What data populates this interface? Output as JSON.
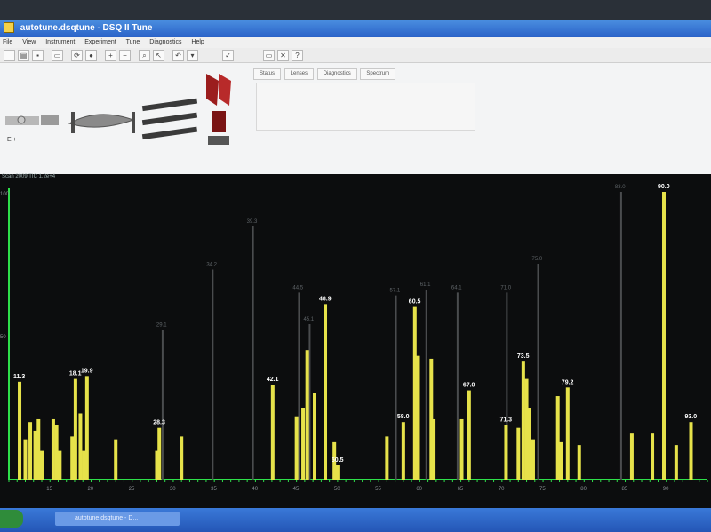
{
  "window": {
    "title": "autotune.dsqtune - DSQ II Tune",
    "menu": [
      "File",
      "View",
      "Instrument",
      "Experiment",
      "Tune",
      "Diagnostics",
      "Help"
    ]
  },
  "instrument": {
    "ei_label": "EI+"
  },
  "tabs": [
    "Status",
    "Lenses",
    "Diagnostics",
    "Spectrum"
  ],
  "plot": {
    "scan_label": "Scan 2009 TIC 1.2e+4",
    "y_top_label": "100",
    "y_mid_label": "50"
  },
  "taskbar": {
    "item_label": "autotune.dsqtune - D..."
  },
  "chart_data": {
    "type": "bar",
    "title": "",
    "xlabel": "",
    "ylabel": "",
    "xlim": [
      10,
      95
    ],
    "ylim": [
      0,
      100
    ],
    "x_ticks": [
      15,
      20,
      25,
      30,
      35,
      40,
      45,
      50,
      55,
      60,
      65,
      70,
      75,
      80,
      85,
      90
    ],
    "colors": {
      "bright": "#e6e24a",
      "faint": "#4a4c4e",
      "axis": "#2ee04a"
    },
    "peaks": [
      {
        "x": 11.3,
        "y": 34,
        "label": "11.3",
        "bright": true
      },
      {
        "x": 12.0,
        "y": 14,
        "bright": true
      },
      {
        "x": 12.6,
        "y": 20,
        "bright": true
      },
      {
        "x": 13.2,
        "y": 17,
        "bright": true
      },
      {
        "x": 13.6,
        "y": 21,
        "bright": true
      },
      {
        "x": 14.0,
        "y": 10,
        "bright": true
      },
      {
        "x": 15.4,
        "y": 21,
        "bright": true
      },
      {
        "x": 15.8,
        "y": 19,
        "bright": true
      },
      {
        "x": 16.2,
        "y": 10,
        "bright": true
      },
      {
        "x": 18.1,
        "y": 35,
        "label": "18.1",
        "bright": true
      },
      {
        "x": 17.7,
        "y": 15,
        "bright": true
      },
      {
        "x": 18.7,
        "y": 23,
        "bright": true
      },
      {
        "x": 19.5,
        "y": 36,
        "label": "19.9",
        "bright": true
      },
      {
        "x": 19.1,
        "y": 10,
        "bright": true
      },
      {
        "x": 23.0,
        "y": 14,
        "bright": true
      },
      {
        "x": 28.3,
        "y": 18,
        "label": "28.3",
        "bright": true
      },
      {
        "x": 28.0,
        "y": 10,
        "bright": true
      },
      {
        "x": 31.0,
        "y": 15,
        "bright": true
      },
      {
        "x": 28.7,
        "y": 52,
        "label": "29.1",
        "bright": false
      },
      {
        "x": 34.8,
        "y": 73,
        "label": "34.2",
        "bright": false
      },
      {
        "x": 39.7,
        "y": 88,
        "label": "39.3",
        "bright": false
      },
      {
        "x": 42.1,
        "y": 33,
        "label": "42.1",
        "bright": true
      },
      {
        "x": 45.0,
        "y": 22,
        "bright": true
      },
      {
        "x": 45.3,
        "y": 65,
        "label": "44.5",
        "bright": false
      },
      {
        "x": 45.8,
        "y": 25,
        "bright": true
      },
      {
        "x": 46.3,
        "y": 45,
        "bright": true
      },
      {
        "x": 46.6,
        "y": 54,
        "label": "45.1",
        "bright": false
      },
      {
        "x": 47.2,
        "y": 30,
        "bright": true
      },
      {
        "x": 48.5,
        "y": 61,
        "label": "48.9",
        "bright": true
      },
      {
        "x": 49.6,
        "y": 13,
        "bright": true
      },
      {
        "x": 50.0,
        "y": 5,
        "label": "50.5",
        "bright": true
      },
      {
        "x": 56.0,
        "y": 15,
        "bright": true
      },
      {
        "x": 57.1,
        "y": 64,
        "label": "57.1",
        "bright": false
      },
      {
        "x": 58.0,
        "y": 20,
        "label": "58.0",
        "bright": true
      },
      {
        "x": 59.4,
        "y": 60,
        "label": "60.5",
        "bright": true
      },
      {
        "x": 59.8,
        "y": 43,
        "bright": true
      },
      {
        "x": 60.8,
        "y": 66,
        "label": "61.1",
        "bright": false
      },
      {
        "x": 61.4,
        "y": 42,
        "bright": true
      },
      {
        "x": 61.7,
        "y": 21,
        "bright": true
      },
      {
        "x": 64.6,
        "y": 65,
        "label": "64.1",
        "bright": false
      },
      {
        "x": 65.1,
        "y": 21,
        "bright": true
      },
      {
        "x": 66.0,
        "y": 31,
        "label": "67.0",
        "bright": true
      },
      {
        "x": 70.5,
        "y": 19,
        "label": "71.3",
        "bright": true
      },
      {
        "x": 70.6,
        "y": 65,
        "label": "71.0",
        "bright": false
      },
      {
        "x": 72.0,
        "y": 18,
        "bright": true
      },
      {
        "x": 72.6,
        "y": 41,
        "label": "73.5",
        "bright": true
      },
      {
        "x": 73.0,
        "y": 35,
        "bright": true
      },
      {
        "x": 73.3,
        "y": 25,
        "bright": true
      },
      {
        "x": 73.8,
        "y": 14,
        "bright": true
      },
      {
        "x": 74.4,
        "y": 75,
        "label": "75.0",
        "bright": false
      },
      {
        "x": 76.8,
        "y": 29,
        "bright": true
      },
      {
        "x": 77.2,
        "y": 13,
        "bright": true
      },
      {
        "x": 78.0,
        "y": 32,
        "label": "79.2",
        "bright": true
      },
      {
        "x": 79.4,
        "y": 12,
        "bright": true
      },
      {
        "x": 84.5,
        "y": 100,
        "label": "83.0",
        "bright": false
      },
      {
        "x": 85.8,
        "y": 16,
        "bright": true
      },
      {
        "x": 88.3,
        "y": 16,
        "bright": true
      },
      {
        "x": 89.7,
        "y": 100,
        "label": "90.0",
        "bright": true
      },
      {
        "x": 91.2,
        "y": 12,
        "bright": true
      },
      {
        "x": 93.0,
        "y": 20,
        "label": "93.0",
        "bright": true
      }
    ]
  }
}
